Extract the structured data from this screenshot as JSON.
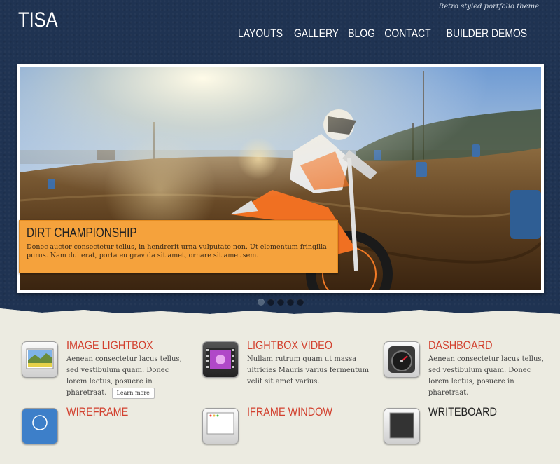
{
  "site": {
    "logo": "TISA",
    "tagline": "Retro styled portfolio theme"
  },
  "nav": [
    {
      "label": "LAYOUTS"
    },
    {
      "label": "GALLERY"
    },
    {
      "label": "BLOG"
    },
    {
      "label": "CONTACT"
    },
    {
      "label": "BUILDER DEMOS"
    }
  ],
  "slider": {
    "caption_title": "DIRT CHAMPIONSHIP",
    "caption_text": "Donec auctor consectetur tellus, in hendrerit urna vulputate non. Ut elementum fringilla purus. Nam dui erat, porta eu gravida sit amet, ornare sit amet sem.",
    "slide_count": 5,
    "active_slide": 1
  },
  "features": [
    {
      "title": "IMAGE LIGHTBOX",
      "text": "Aenean consectetur lacus tellus, sed vestibulum quam. Donec lorem lectus, posuere in pharetraat.",
      "button": "Learn more",
      "icon": "landscape-photo-icon"
    },
    {
      "title": "LIGHTBOX VIDEO",
      "text": "Nullam rutrum quam ut massa ultricies Mauris varius fermentum velit sit amet varius.",
      "icon": "video-film-icon"
    },
    {
      "title": "DASHBOARD",
      "text": "Aenean consectetur lacus tellus, sed vestibulum quam. Donec lorem lectus, posuere in pharetraat.",
      "icon": "speedometer-icon"
    },
    {
      "title": "WIREFRAME",
      "text": "",
      "icon": "blueprint-icon"
    },
    {
      "title": "IFRAME WINDOW",
      "text": "",
      "icon": "browser-window-icon"
    },
    {
      "title": "WRITEBOARD",
      "text": "",
      "icon": "writeboard-icon"
    }
  ],
  "colors": {
    "header_bg": "#1f3352",
    "accent_red": "#d2412f",
    "caption_orange": "#f5a23c",
    "body_bg": "#ecebe1"
  }
}
